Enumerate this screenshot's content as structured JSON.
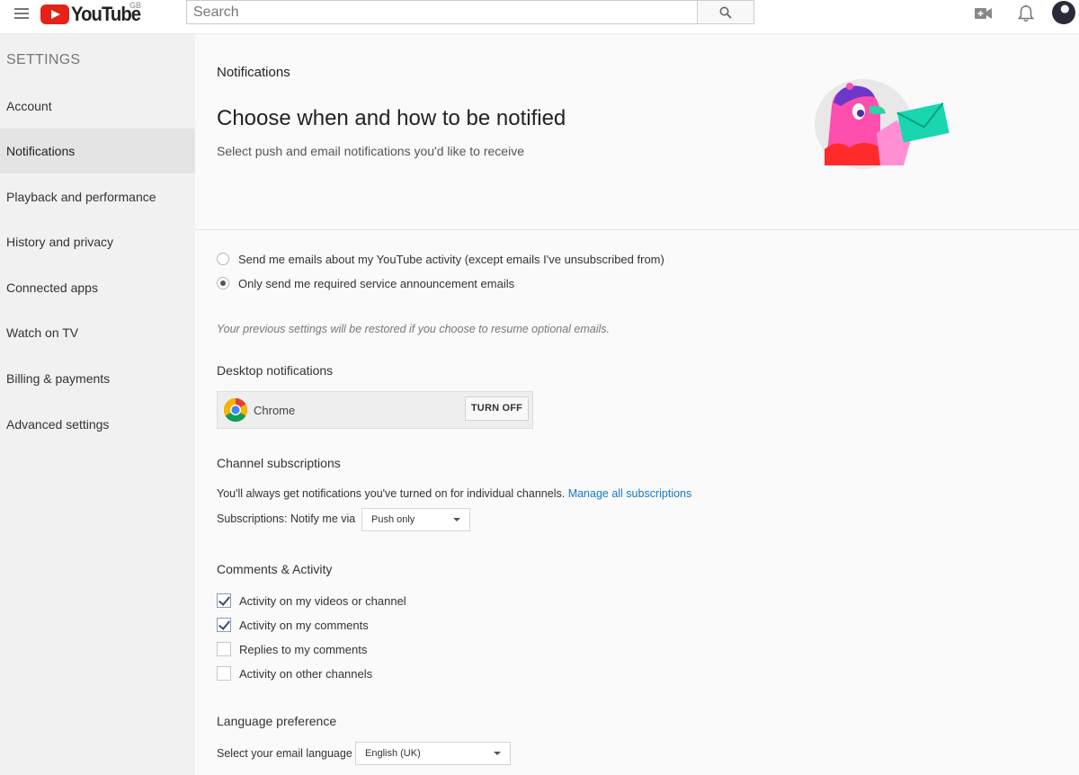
{
  "header": {
    "logo_text": "YouTube",
    "region": "GB",
    "search_placeholder": "Search"
  },
  "sidebar": {
    "heading": "SETTINGS",
    "items": [
      {
        "label": "Account",
        "active": false
      },
      {
        "label": "Notifications",
        "active": true
      },
      {
        "label": "Playback and performance",
        "active": false
      },
      {
        "label": "History and privacy",
        "active": false
      },
      {
        "label": "Connected apps",
        "active": false
      },
      {
        "label": "Watch on TV",
        "active": false
      },
      {
        "label": "Billing & payments",
        "active": false
      },
      {
        "label": "Advanced settings",
        "active": false
      }
    ]
  },
  "main": {
    "page_heading": "Notifications",
    "title": "Choose when and how to be notified",
    "subtitle": "Select push and email notifications you'd like to receive",
    "email_options": [
      {
        "label": "Send me emails about my YouTube activity (except emails I've unsubscribed from)",
        "checked": false
      },
      {
        "label": "Only send me required service announcement emails",
        "checked": true
      }
    ],
    "restore_note": "Your previous settings will be restored if you choose to resume optional emails.",
    "desktop": {
      "title": "Desktop notifications",
      "browser": "Chrome",
      "button": "TURN OFF"
    },
    "subscriptions": {
      "title": "Channel subscriptions",
      "text": "You'll always get notifications you've turned on for individual channels.",
      "link": "Manage all subscriptions",
      "notify_label": "Subscriptions: Notify me via",
      "notify_value": "Push only"
    },
    "comments": {
      "title": "Comments & Activity",
      "items": [
        {
          "label": "Activity on my videos or channel",
          "checked": true
        },
        {
          "label": "Activity on my comments",
          "checked": true
        },
        {
          "label": "Replies to my comments",
          "checked": false
        },
        {
          "label": "Activity on other channels",
          "checked": false
        }
      ]
    },
    "language": {
      "title": "Language preference",
      "label": "Select your email language",
      "value": "English (UK)"
    }
  },
  "colors": {
    "brand_red": "#e62117",
    "link_blue": "#167ac6"
  },
  "icons": [
    "hamburger-icon",
    "youtube-logo-icon",
    "search-icon",
    "video-camera-icon",
    "bell-icon",
    "chrome-icon"
  ]
}
